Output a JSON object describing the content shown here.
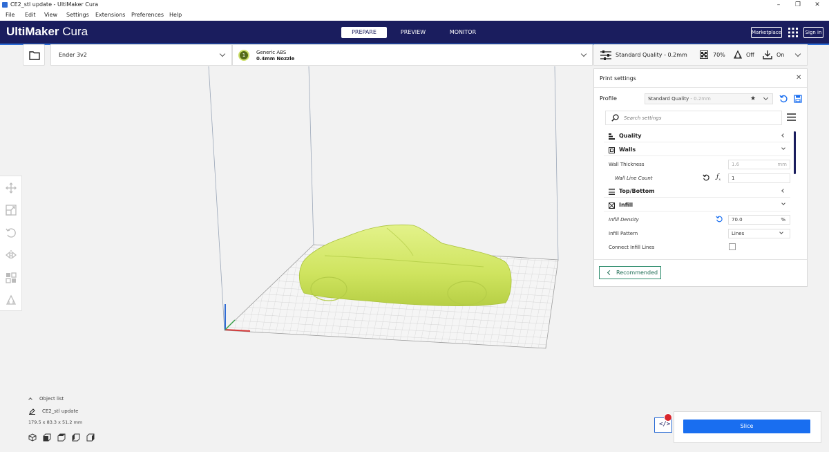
{
  "window": {
    "title": "CE2_stl update - UltiMaker Cura",
    "min": "–",
    "max": "❐",
    "close": "✕"
  },
  "menu": [
    "File",
    "Edit",
    "View",
    "Settings",
    "Extensions",
    "Preferences",
    "Help"
  ],
  "header": {
    "logo_bold": "UltiMaker",
    "logo_light": " Cura",
    "stages": [
      "PREPARE",
      "PREVIEW",
      "MONITOR"
    ],
    "marketplace": "Marketplace",
    "signin": "Sign in"
  },
  "toolbar": {
    "printer": "Ender 3v2",
    "extruder_number": "1",
    "material": "Generic ABS",
    "nozzle": "0.4mm Nozzle",
    "quality": "Standard Quality - 0.2mm",
    "infill": "70%",
    "support": "Off",
    "adhesion": "On"
  },
  "print_settings": {
    "title": "Print settings",
    "profile_label": "Profile",
    "profile_name": "Standard Quality",
    "profile_suffix": " - 0.2mm",
    "search_placeholder": "Search settings",
    "sections": {
      "quality": "Quality",
      "walls": "Walls",
      "topbottom": "Top/Bottom",
      "infill": "Infill"
    },
    "wall_thickness_label": "Wall Thickness",
    "wall_thickness_value": "1.6",
    "wall_thickness_unit": "mm",
    "wall_line_count_label": "Wall Line Count",
    "wall_line_count_value": "1",
    "infill_density_label": "Infill Density",
    "infill_density_value": "70.0",
    "infill_density_unit": "%",
    "infill_pattern_label": "Infill Pattern",
    "infill_pattern_value": "Lines",
    "connect_infill_label": "Connect Infill Lines",
    "recommended": "Recommended"
  },
  "object": {
    "list_label": "Object list",
    "name": "CE2_stl update",
    "dimensions": "179.5 x 83.3 x 51.2 mm"
  },
  "slice": {
    "label": "Slice"
  },
  "colors": {
    "header": "#1a1d5e",
    "accent": "#196ef0",
    "model": "#d7ec6e"
  }
}
